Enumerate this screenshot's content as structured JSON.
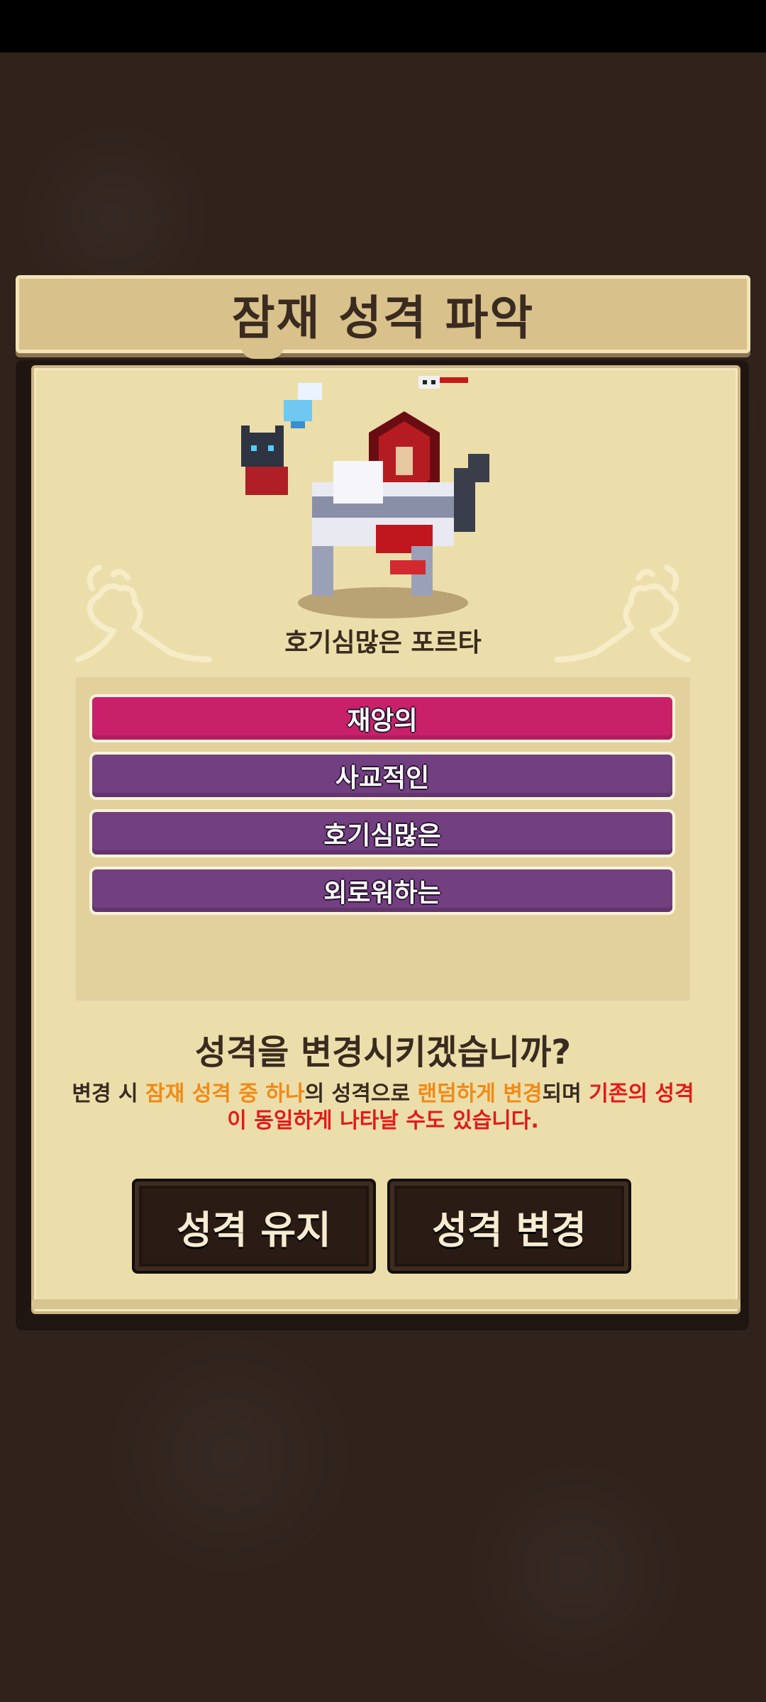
{
  "dialog": {
    "title": "잠재 성격 파악",
    "character_name": "호기심많은 포르타"
  },
  "traits": [
    {
      "label": "재앙의",
      "selected": true
    },
    {
      "label": "사교적인",
      "selected": false
    },
    {
      "label": "호기심많은",
      "selected": false
    },
    {
      "label": "외로워하는",
      "selected": false
    }
  ],
  "question": "성격을 변경시키겠습니까?",
  "description": {
    "p1": "변경 시 ",
    "p2": "잠재 성격 중 하나",
    "p3": "의 성격으로 ",
    "p4": "랜덤하게 변경",
    "p5": "되며 ",
    "p6": "기존의 성격이 동일하게 나타날 수도 있습니다."
  },
  "buttons": {
    "keep": "성격 유지",
    "change": "성격 변경"
  },
  "colors": {
    "selected_trait": "#c9206a",
    "normal_trait": "#723f80",
    "highlight_orange": "#f08a18",
    "highlight_red": "#e31a1a"
  }
}
